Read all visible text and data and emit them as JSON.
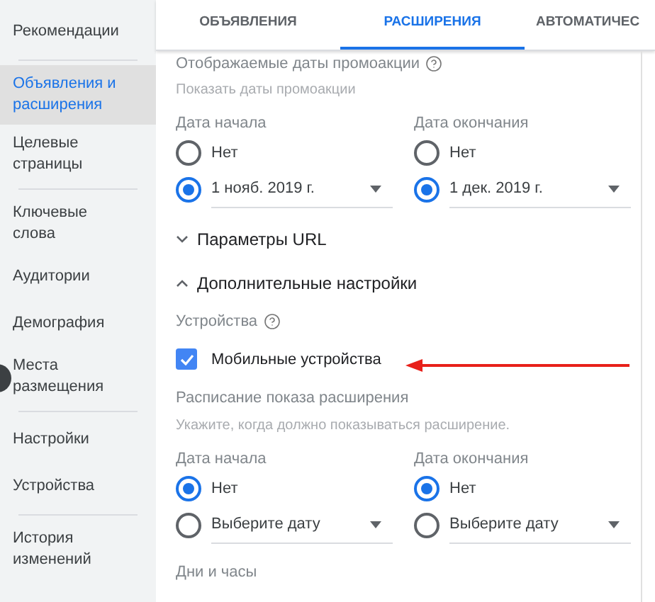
{
  "sidebar": {
    "groups": [
      {
        "items": [
          {
            "label": "Рекомендации",
            "selected": false
          }
        ]
      },
      {
        "items": [
          {
            "label": "Объявления и расширения",
            "selected": true
          },
          {
            "label": "Целевые страницы",
            "selected": false
          }
        ]
      },
      {
        "items": [
          {
            "label": "Ключевые слова",
            "selected": false
          },
          {
            "label": "Аудитории",
            "selected": false
          },
          {
            "label": "Демография",
            "selected": false
          },
          {
            "label": "Места размещения",
            "selected": false
          }
        ]
      },
      {
        "items": [
          {
            "label": "Настройки",
            "selected": false
          },
          {
            "label": "Устройства",
            "selected": false
          }
        ]
      },
      {
        "items": [
          {
            "label": "История изменений",
            "selected": false
          }
        ]
      }
    ]
  },
  "tabs": [
    {
      "label": "ОБЪЯВЛЕНИЯ",
      "selected": false
    },
    {
      "label": "РАСШИРЕНИЯ",
      "selected": true
    },
    {
      "label": "АВТОМАТИЧЕС",
      "selected": false
    }
  ],
  "promo_dates": {
    "title": "Отображаемые даты промоакции",
    "hint": "Показать даты промоакции",
    "columns": [
      {
        "label": "Дата начала",
        "options": [
          {
            "kind": "plain",
            "label": "Нет",
            "selected": false
          },
          {
            "kind": "dropdown",
            "label": "1 нояб. 2019 г.",
            "selected": true
          }
        ]
      },
      {
        "label": "Дата окончания",
        "options": [
          {
            "kind": "plain",
            "label": "Нет",
            "selected": false
          },
          {
            "kind": "dropdown",
            "label": "1 дек. 2019 г.",
            "selected": true
          }
        ]
      }
    ]
  },
  "sections": [
    {
      "label": "Параметры URL",
      "expanded": false
    },
    {
      "label": "Дополнительные настройки",
      "expanded": true
    }
  ],
  "devices": {
    "label": "Устройства",
    "checkbox": {
      "label": "Мобильные устройства",
      "checked": true
    }
  },
  "schedule": {
    "title": "Расписание показа расширения",
    "hint": "Укажите, когда должно показываться расширение.",
    "columns": [
      {
        "label": "Дата начала",
        "options": [
          {
            "kind": "plain",
            "label": "Нет",
            "selected": true
          },
          {
            "kind": "dropdown",
            "label": "Выберите дату",
            "selected": false
          }
        ]
      },
      {
        "label": "Дата окончания",
        "options": [
          {
            "kind": "plain",
            "label": "Нет",
            "selected": true
          },
          {
            "kind": "dropdown",
            "label": "Выберите дату",
            "selected": false
          }
        ]
      }
    ],
    "days_label": "Дни и часы"
  }
}
